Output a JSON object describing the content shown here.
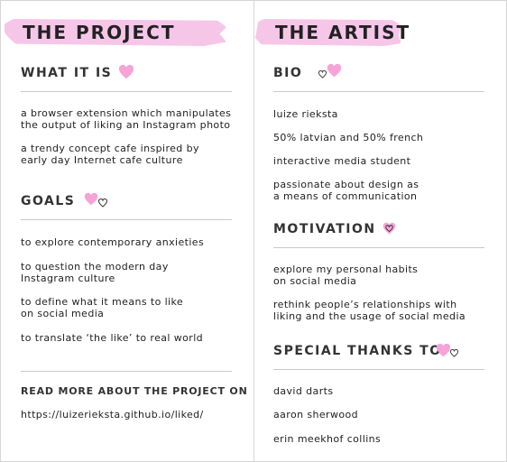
{
  "project": {
    "title": "THE PROJECT",
    "what_it_is": {
      "heading": "WHAT IT IS",
      "items": [
        "a browser extension which manipulates\nthe output of liking an Instagram photo",
        "a trendy concept cafe inspired by\nearly day Internet cafe culture"
      ]
    },
    "goals": {
      "heading": "GOALS",
      "items": [
        "to explore contemporary anxieties",
        "to question the modern day\nInstagram culture",
        "to define what it means to like\non social media",
        "to translate ‘the like’ to real world"
      ]
    },
    "read_more": {
      "heading": "READ MORE ABOUT THE PROJECT ON",
      "url": "https://luizerieksta.github.io/liked/"
    }
  },
  "artist": {
    "title": "THE ARTIST",
    "bio": {
      "heading": "BIO",
      "items": [
        "luize rieksta",
        "50% latvian and 50% french",
        "interactive media student",
        "passionate about design as\na means of communication"
      ]
    },
    "motivation": {
      "heading": "MOTIVATION",
      "items": [
        "explore my personal habits\non social media",
        "rethink people’s relationships with\nliking and the usage of social media"
      ]
    },
    "thanks": {
      "heading": "SPECIAL THANKS TO",
      "items": [
        "david darts",
        "aaron sherwood",
        "erin meekhof collins"
      ]
    }
  },
  "colors": {
    "brush": "#f6c6e8",
    "heart_pink": "#f7a3d8",
    "text": "#222222",
    "rule": "#c9c9c9"
  }
}
